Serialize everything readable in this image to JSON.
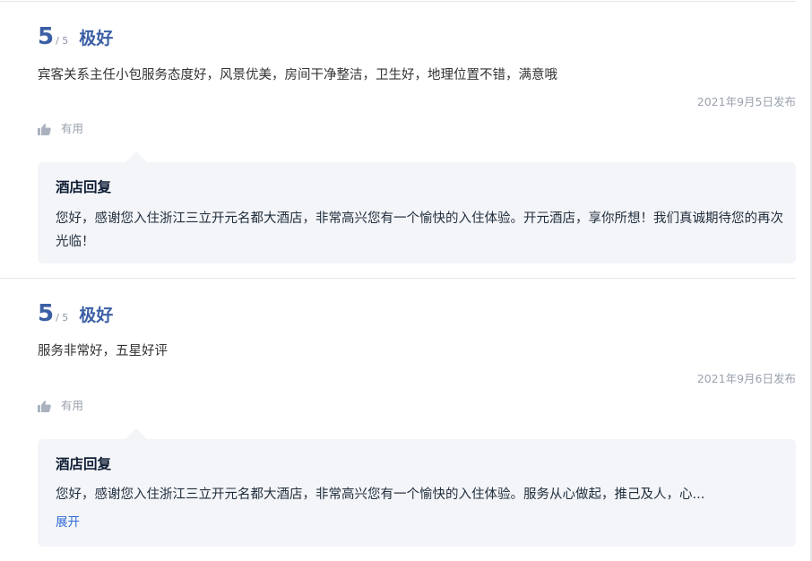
{
  "reviews": [
    {
      "score": "5",
      "score_max": "/ 5",
      "rating_text": "极好",
      "comment": "宾客关系主任小包服务态度好，风景优美，房间干净整洁，卫生好，地理位置不错，满意哦",
      "date": "2021年9月5日发布",
      "helpful_label": "有用",
      "reply": {
        "title": "酒店回复",
        "body": "您好，感谢您入住浙江三立开元名都大酒店，非常高兴您有一个愉快的入住体验。开元酒店，享你所想！我们真诚期待您的再次光临！"
      }
    },
    {
      "score": "5",
      "score_max": "/ 5",
      "rating_text": "极好",
      "comment": "服务非常好，五星好评",
      "date": "2021年9月6日发布",
      "helpful_label": "有用",
      "reply": {
        "title": "酒店回复",
        "body": "您好，感谢您入住浙江三立开元名都大酒店，非常高兴您有一个愉快的入住体验。服务从心做起，推己及人，心...",
        "expand_label": "展开"
      }
    }
  ],
  "icons": {
    "helpful": "thumbs-up-icon"
  },
  "colors": {
    "score": "#3b5fa5",
    "reply_bg": "#f4f5f8",
    "link": "#2f6bd8"
  }
}
